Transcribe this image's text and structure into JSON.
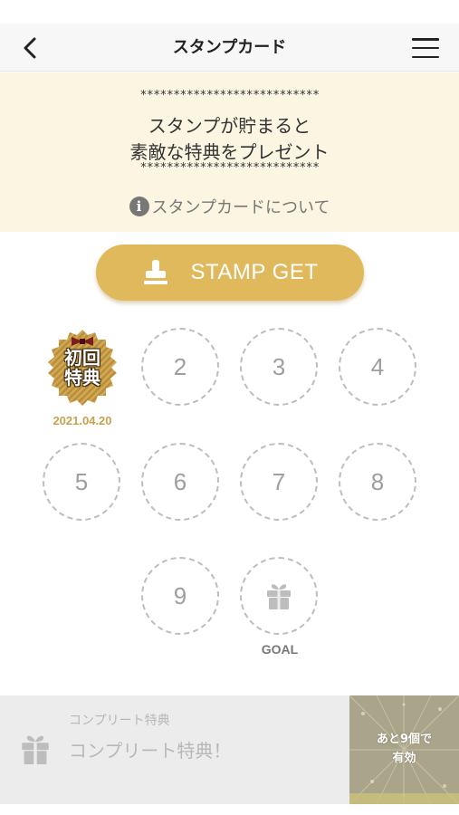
{
  "nav": {
    "title": "スタンプカード"
  },
  "banner": {
    "stars": "***************************",
    "message_line1": "スタンプが貯まると",
    "message_line2": "素敵な特典をプレゼント",
    "about_link": "スタンプカードについて",
    "bg_color": "#fbf5e1"
  },
  "stamp_button": {
    "label": "STAMP GET",
    "color": "#dfb95c"
  },
  "stamps": {
    "first": {
      "badge_line1": "初回",
      "badge_line2": "特典",
      "date": "2021.04.20",
      "accent": "#c8a14e"
    },
    "slots": [
      "2",
      "3",
      "4",
      "5",
      "6",
      "7",
      "8",
      "9"
    ],
    "goal_label": "GOAL"
  },
  "complete": {
    "small_label": "コンプリート特典",
    "title": "コンプリート特典！",
    "remain_line1": "あと9個で",
    "remain_line2": "有効"
  }
}
